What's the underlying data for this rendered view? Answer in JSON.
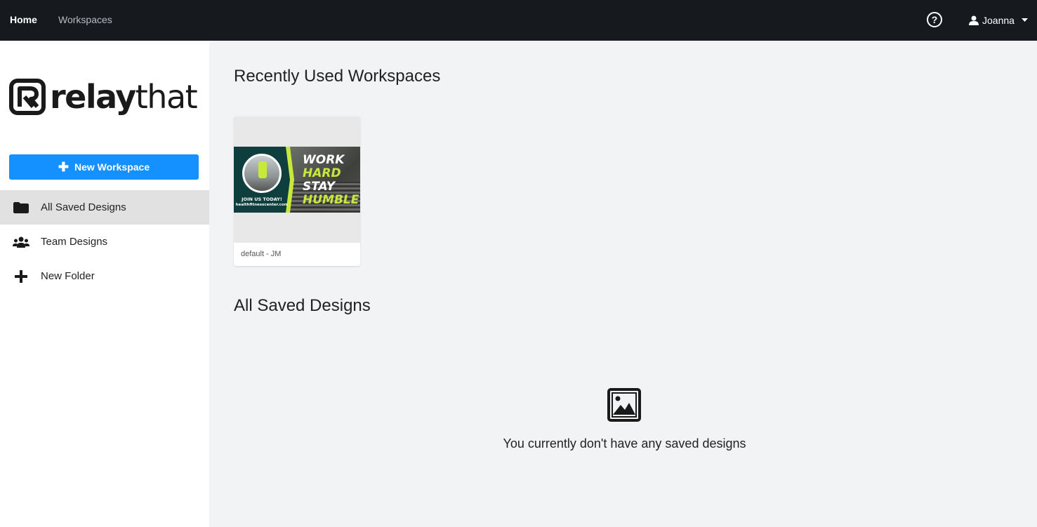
{
  "nav": {
    "home": "Home",
    "workspaces": "Workspaces",
    "user": "Joanna"
  },
  "sidebar": {
    "logo_bold": "relay",
    "logo_light": "that",
    "new_workspace": "New Workspace",
    "items": [
      {
        "label": "All Saved Designs",
        "icon": "folder-icon",
        "active": true
      },
      {
        "label": "Team Designs",
        "icon": "users-icon",
        "active": false
      },
      {
        "label": "New Folder",
        "icon": "plus-icon",
        "active": false
      }
    ]
  },
  "main": {
    "recent_title": "Recently Used Workspaces",
    "workspace_card": {
      "caption": "default - JM",
      "thumbnail_text": {
        "line1": "WORK",
        "line2": "HARD",
        "line3": "STAY",
        "line4": "HUMBLE",
        "cta": "JOIN US TODAY!",
        "url": "healthfitnesscenter.com"
      }
    },
    "saved_title": "All Saved Designs",
    "empty_message": "You currently don't have any saved designs"
  },
  "colors": {
    "topbar": "#161a1f",
    "accent": "#1590ff",
    "lime": "#c8e83a",
    "teal": "#0f3e3e"
  }
}
